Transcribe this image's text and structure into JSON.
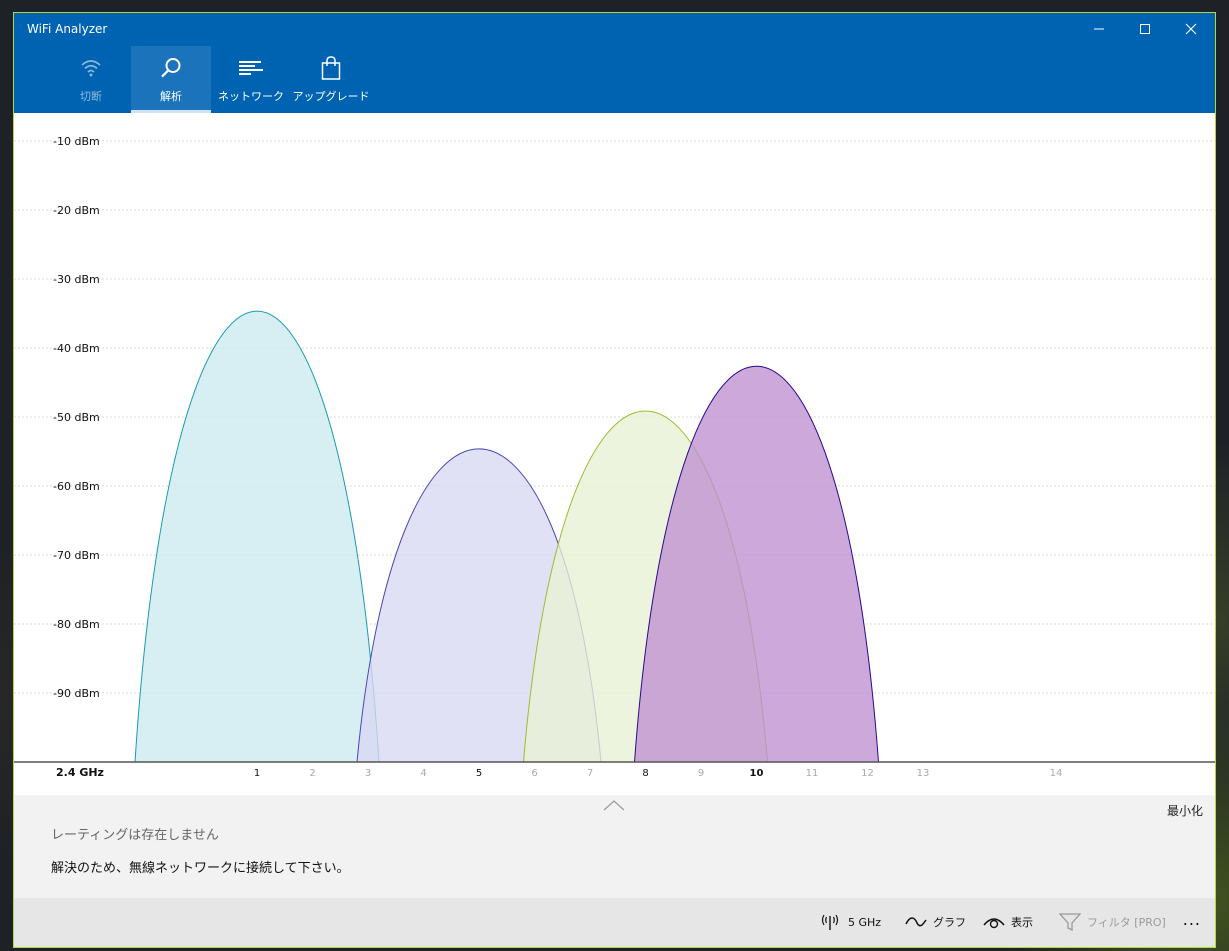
{
  "window": {
    "title": "WiFi Analyzer",
    "controls": {
      "minimize": "minimize-icon",
      "maximize": "maximize-icon",
      "close": "close-icon"
    }
  },
  "nav": {
    "tabs": [
      {
        "label": "切断",
        "icon": "wifi-icon",
        "active": false
      },
      {
        "label": "解析",
        "icon": "magnifier-icon",
        "active": true
      },
      {
        "label": "ネットワーク",
        "icon": "network-list-icon",
        "active": false
      },
      {
        "label": "アップグレード",
        "icon": "shopping-bag-icon",
        "active": false
      }
    ]
  },
  "chart_data": {
    "type": "area",
    "title": "",
    "xlabel": "2.4 GHz",
    "ylabel": "",
    "y_ticks": [
      "-10 dBm",
      "-20 dBm",
      "-30 dBm",
      "-40 dBm",
      "-50 dBm",
      "-60 dBm",
      "-70 dBm",
      "-80 dBm",
      "-90 dBm"
    ],
    "x_ticks": [
      {
        "label": "1",
        "channel": 1,
        "emphasis": false
      },
      {
        "label": "2",
        "channel": 2,
        "emphasis": false
      },
      {
        "label": "3",
        "channel": 3,
        "emphasis": false
      },
      {
        "label": "4",
        "channel": 4,
        "emphasis": false
      },
      {
        "label": "5",
        "channel": 5,
        "emphasis": false
      },
      {
        "label": "6",
        "channel": 6,
        "emphasis": false
      },
      {
        "label": "7",
        "channel": 7,
        "emphasis": false
      },
      {
        "label": "8",
        "channel": 8,
        "emphasis": false
      },
      {
        "label": "9",
        "channel": 9,
        "emphasis": false
      },
      {
        "label": "10",
        "channel": 10,
        "emphasis": true
      },
      {
        "label": "11",
        "channel": 11,
        "emphasis": false
      },
      {
        "label": "12",
        "channel": 12,
        "emphasis": false
      },
      {
        "label": "13",
        "channel": 13,
        "emphasis": false
      },
      {
        "label": "14",
        "channel": 14,
        "emphasis": false
      }
    ],
    "ylim": [
      -100,
      -5
    ],
    "grid": true,
    "series": [
      {
        "center_channel": 1,
        "peak_dbm": -34.5,
        "fill": "#cce9ee",
        "stroke": "#1a9bb0"
      },
      {
        "center_channel": 5,
        "peak_dbm": -54.5,
        "fill": "#d8d8f4",
        "stroke": "#4848b8"
      },
      {
        "center_channel": 8,
        "peak_dbm": -49,
        "fill": "#e8f1d3",
        "stroke": "#9cbd30"
      },
      {
        "center_channel": 10,
        "peak_dbm": -42.5,
        "fill": "#bf8fd0",
        "stroke": "#2a0a8a"
      }
    ]
  },
  "panel": {
    "minimize_label": "最小化",
    "rating_text": "レーティングは存在しません",
    "instruction_text": "解決のため、無線ネットワークに接続して下さい。"
  },
  "commandbar": {
    "band": {
      "label": "5 GHz",
      "icon": "antenna-icon"
    },
    "graph": {
      "label": "グラフ",
      "icon": "wave-icon"
    },
    "view": {
      "label": "表示",
      "icon": "eye-icon"
    },
    "filter": {
      "label": "フィルタ [PRO]",
      "icon": "filter-icon",
      "enabled": false
    },
    "more": "..."
  }
}
